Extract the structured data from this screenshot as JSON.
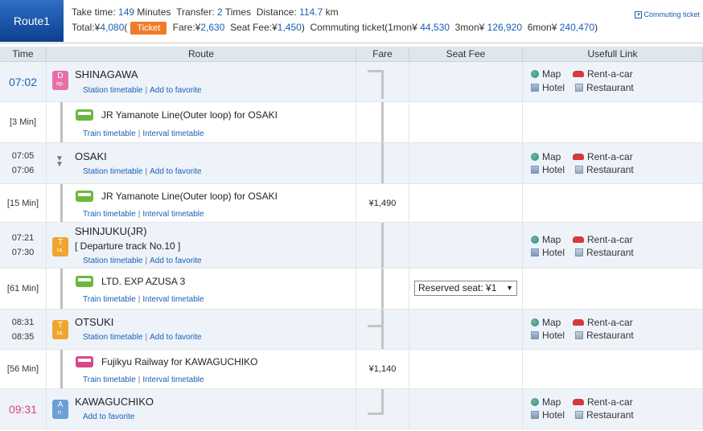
{
  "summary": {
    "route": "Route1",
    "take_time_label": "Take time:",
    "take_time": "149",
    "minutes": "Minutes",
    "transfer_label": "Transfer:",
    "transfer": "2",
    "times": "Times",
    "distance_label": "Distance:",
    "distance": "114.7",
    "km": "km",
    "total_label": "Total:¥",
    "total": "4,080",
    "paren_open": "(",
    "ticket": "Ticket",
    "fare_label": "Fare:¥",
    "fare": "2,630",
    "seat_fee_label": "Seat Fee:¥",
    "seat_fee": "1,450",
    "paren_close": ")",
    "commuting_label": "Commuting ticket(1mon¥",
    "mon1": "44,530",
    "mon3_label": "3mon¥",
    "mon3": "126,920",
    "mon6_label": "6mon¥",
    "mon6": "240,470",
    "commuting_close": ")",
    "commuting_link": "Commuting ticket"
  },
  "headers": {
    "time": "Time",
    "route": "Route",
    "fare": "Fare",
    "seat": "Seat Fee",
    "link": "Usefull Link"
  },
  "common": {
    "station_timetable": "Station timetable",
    "add_favorite": "Add to favorite",
    "train_timetable": "Train timetable",
    "interval_timetable": "Interval timetable",
    "sep": "|",
    "map": "Map",
    "hotel": "Hotel",
    "rent": "Rent-a-car",
    "restaurant": "Restaurant"
  },
  "rows": {
    "shinagawa": {
      "time": "07:02",
      "badge_top": "D",
      "badge_bottom": "ep.",
      "name": "SHINAGAWA"
    },
    "m1": {
      "duration": "[3 Min]",
      "line": "JR Yamanote Line(Outer loop)  for OSAKI"
    },
    "osaki": {
      "arr": "07:05",
      "dep": "07:06",
      "name": "OSAKI"
    },
    "m2": {
      "duration": "[15 Min]",
      "line": "JR Yamanote Line(Outer loop)  for OSAKI",
      "fare": "¥1,490"
    },
    "shinjuku": {
      "arr": "07:21",
      "dep": "07:30",
      "badge_top": "T",
      "badge_bottom": "ra.",
      "name": "SHINJUKU(JR)",
      "track": "[ Departure track No.10 ]"
    },
    "m3": {
      "duration": "[61 Min]",
      "line": "LTD. EXP AZUSA 3",
      "seat": "Reserved seat: ¥1"
    },
    "otsuki": {
      "arr": "08:31",
      "dep": "08:35",
      "badge_top": "T",
      "badge_bottom": "ra.",
      "name": "OTSUKI"
    },
    "m4": {
      "duration": "[56 Min]",
      "line": "Fujikyu Railway  for KAWAGUCHIKO",
      "fare": "¥1,140"
    },
    "kawaguchiko": {
      "time": "09:31",
      "badge_top": "A",
      "badge_bottom": "rr.",
      "name": "KAWAGUCHIKO"
    }
  }
}
